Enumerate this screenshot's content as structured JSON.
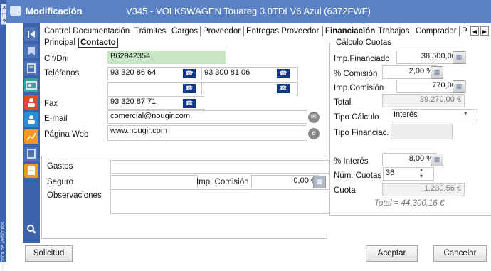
{
  "colors": {
    "title_bar": "#5b82c4",
    "tool_column": "#3a63ab",
    "highlight_field": "#c6e6c4",
    "phone_button": "#0d3a8a"
  },
  "window": {
    "title": "Modificación",
    "subtitle": "V345 - VOLKSWAGEN Touareg 3.0TDI V6 Azul (6372FWF)"
  },
  "side_vertical_text": "Histórico de Vehículos",
  "window_switcher": [
    "×",
    "□",
    "?"
  ],
  "tabs": {
    "items": [
      "Control Documentación",
      "Trámites",
      "Cargos",
      "Proveedor",
      "Entregas Proveedor",
      "Financiación",
      "Trabajos",
      "Comprador",
      "P"
    ],
    "active": "Financiación",
    "subtabs": [
      "Principal",
      "Contacto"
    ],
    "active_subtab": "Contacto",
    "scroll_left": "◀",
    "scroll_right": "▶"
  },
  "contact": {
    "cif_label": "Cif/Dni",
    "cif_value": "B62942354",
    "telefonos_label": "Teléfonos",
    "phone1": "93 320 86 64",
    "phone2": "93 300 81 06",
    "phone3": "",
    "phone4": "",
    "fax_label": "Fax",
    "fax_value": "93 320 87 71",
    "email_label": "E-mail",
    "email_value": "comercial@nougir.com",
    "web_label": "Página Web",
    "web_value": "www.nougir.com"
  },
  "extras": {
    "gastos_label": "Gastos",
    "gastos_value": "",
    "seguro_label": "Seguro",
    "seguro_value": "",
    "imp_comision_label": "Imp. Comisión",
    "imp_comision_value": "0,00 €",
    "observaciones_label": "Observaciones",
    "observaciones_value": ""
  },
  "calculo": {
    "legend": "Cálculo Cuotas",
    "imp_financiado_label": "Imp.Financiado",
    "imp_financiado_value": "38.500,00 €",
    "comision_pct_label": "% Comisión",
    "comision_pct_value": "2,00 %",
    "imp_comision_label": "Imp.Comisión",
    "imp_comision_value": "770,00 €",
    "total_label": "Total",
    "total_value": "39.270,00 €",
    "tipo_calculo_label": "Tipo Cálculo",
    "tipo_calculo_value": "Interés",
    "tipo_financiac_label": "Tipo Financiac.",
    "tipo_financiac_value": "",
    "interes_label": "% Interés",
    "interes_value": "8,00 %",
    "num_cuotas_label": "Núm. Cuotas",
    "num_cuotas_value": "36",
    "cuota_label": "Cuota",
    "cuota_value": "1.230,56 €",
    "total_summary": "Total = 44.300,16 €"
  },
  "buttons": {
    "solicitud": "Solicitud",
    "aceptar": "Aceptar",
    "cancelar": "Cancelar"
  },
  "icons": {
    "phone": "☎",
    "calc": "▦",
    "dropdown": "▾",
    "spin_up": "▴",
    "spin_down": "▾",
    "mail": "✉",
    "web": "e"
  }
}
